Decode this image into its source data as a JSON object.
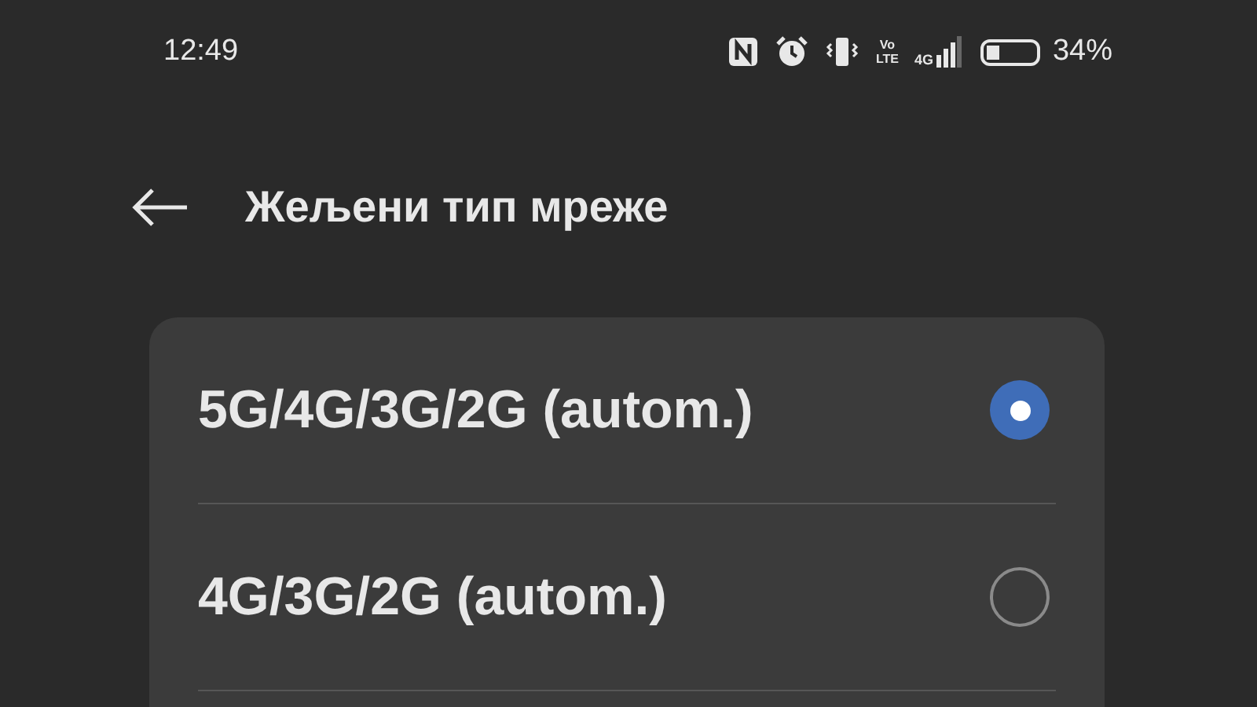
{
  "status_bar": {
    "time": "12:49",
    "volte": {
      "top": "Vo",
      "bottom": "LTE"
    },
    "network": "4G",
    "battery": {
      "level": 0.34,
      "reading": "34%"
    }
  },
  "header": {
    "title": "Жељени тип мреже"
  },
  "options": [
    {
      "label": "5G/4G/3G/2G (autom.)",
      "selected": true
    },
    {
      "label": "4G/3G/2G (autom.)",
      "selected": false
    }
  ]
}
